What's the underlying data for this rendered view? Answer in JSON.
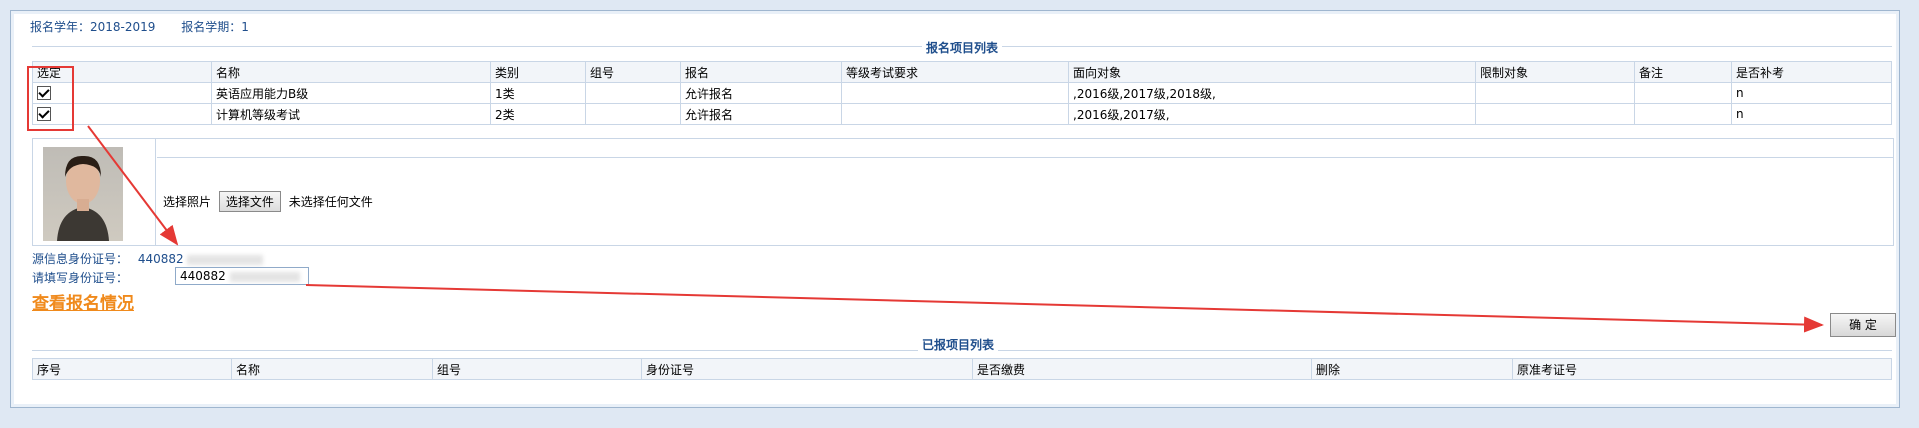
{
  "top": {
    "year_label": "报名学年：",
    "year_value": "2018-2019",
    "term_label": "报名学期：",
    "term_value": "1"
  },
  "projects": {
    "title": "报名项目列表",
    "headers": [
      "选定",
      "名称",
      "类别",
      "组号",
      "报名",
      "等级考试要求",
      "面向对象",
      "限制对象",
      "备注",
      "是否补考"
    ],
    "rows": [
      {
        "checked": true,
        "name": "英语应用能力B级",
        "category": "1类",
        "group": "",
        "enroll": "允许报名",
        "requirement": "",
        "target": ",2016级,2017级,2018级,",
        "limit": "",
        "note": "",
        "makeup": "n"
      },
      {
        "checked": true,
        "name": "计算机等级考试",
        "category": "2类",
        "group": "",
        "enroll": "允许报名",
        "requirement": "",
        "target": ",2016级,2017级,",
        "limit": "",
        "note": "",
        "makeup": "n"
      }
    ]
  },
  "photo": {
    "label": "选择照片",
    "button": "选择文件",
    "status": "未选择任何文件"
  },
  "id": {
    "source_label": "源信息身份证号：",
    "source_value": "440882",
    "input_label": "请填写身份证号：",
    "input_value": "440882"
  },
  "link": "查看报名情况",
  "confirm": "确  定",
  "enrolled": {
    "title": "已报项目列表",
    "headers": [
      "序号",
      "名称",
      "组号",
      "身份证号",
      "是否缴费",
      "删除",
      "原准考证号"
    ]
  },
  "colors": {
    "annotation": "#e53935",
    "accent": "#1f4e8c",
    "link": "#f08a1c"
  }
}
